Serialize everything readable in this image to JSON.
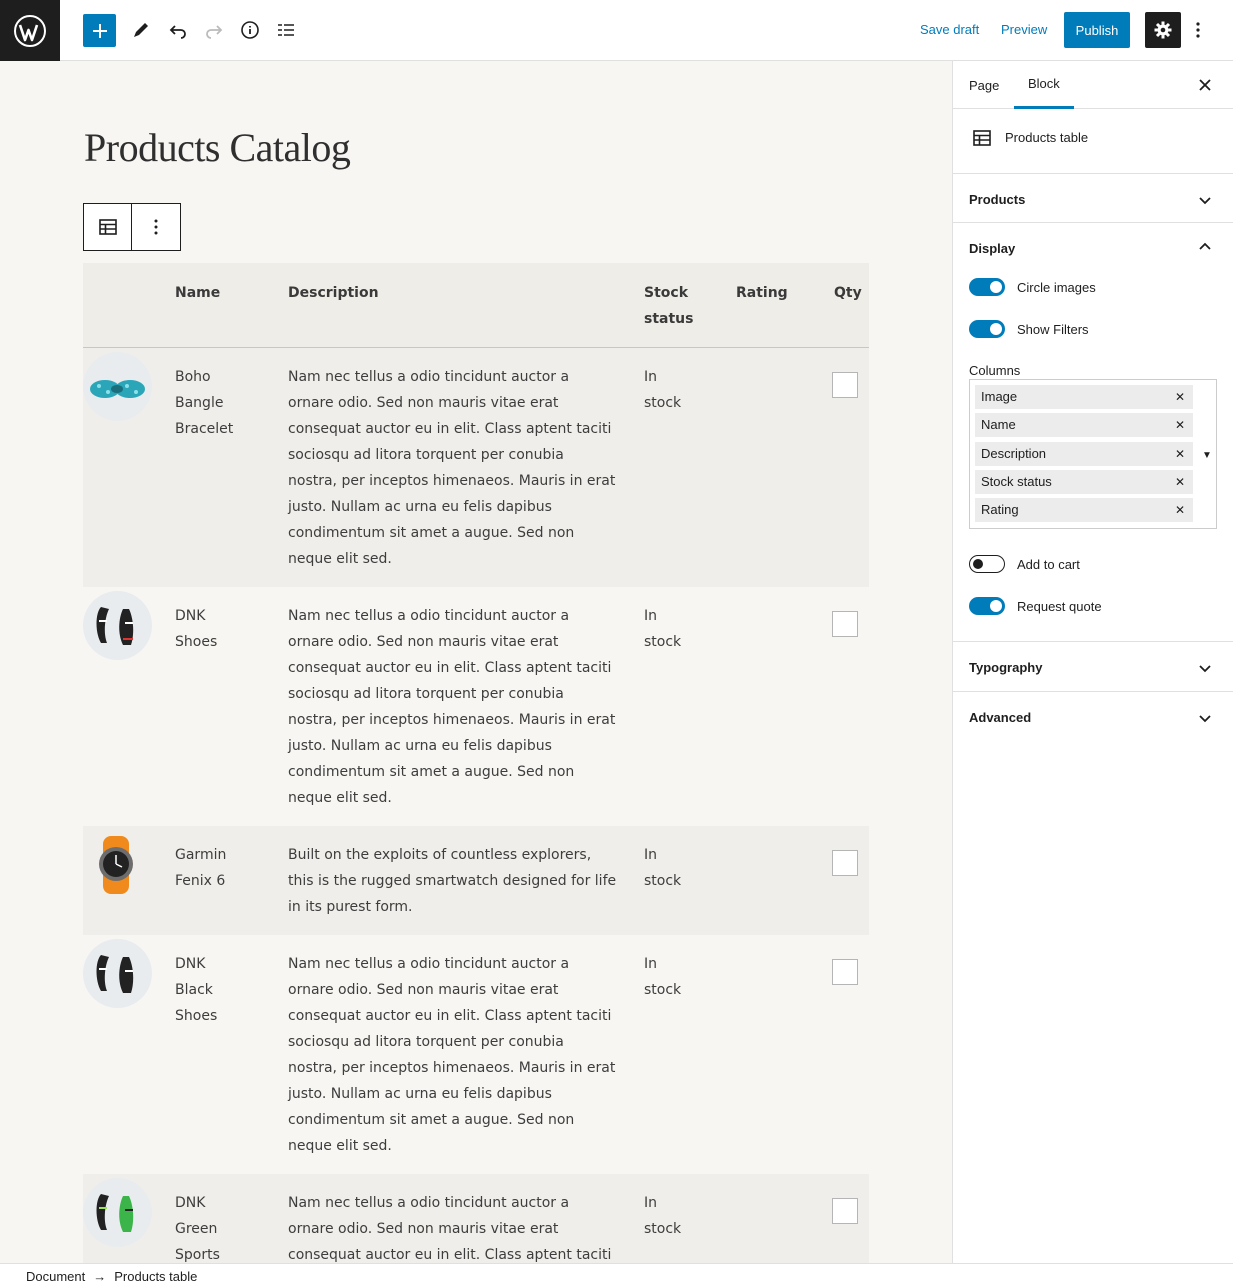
{
  "toolbar": {
    "save_draft": "Save draft",
    "preview": "Preview",
    "publish": "Publish",
    "accent": "#007cba"
  },
  "canvas": {
    "page_title": "Products Catalog"
  },
  "table": {
    "headers": [
      "Name",
      "Description",
      "Stock status",
      "Rating",
      "Qty"
    ],
    "header_stock_lines": [
      "Stock",
      "status"
    ],
    "rows": [
      {
        "image": "turquoise-bracelet",
        "name_lines": [
          "Boho",
          "Bangle",
          "Bracelet"
        ],
        "desc_lines": [
          "Nam nec tellus a odio tincidunt auctor a",
          "ornare odio. Sed non mauris vitae erat",
          "consequat auctor eu in elit. Class aptent taciti",
          "sociosqu ad litora torquent per conubia",
          "nostra, per inceptos himenaeos. Mauris in erat",
          "justo. Nullam ac urna eu felis dapibus",
          "condimentum sit amet a augue. Sed non",
          "neque elit sed."
        ],
        "stock_lines": [
          "In",
          "stock"
        ]
      },
      {
        "image": "sneakers",
        "name_lines": [
          "DNK",
          "Shoes"
        ],
        "desc_lines": [
          "Nam nec tellus a odio tincidunt auctor a",
          "ornare odio. Sed non mauris vitae erat",
          "consequat auctor eu in elit. Class aptent taciti",
          "sociosqu ad litora torquent per conubia",
          "nostra, per inceptos himenaeos. Mauris in erat",
          "justo. Nullam ac urna eu felis dapibus",
          "condimentum sit amet a augue. Sed non",
          "neque elit sed."
        ],
        "stock_lines": [
          "In",
          "stock"
        ]
      },
      {
        "image": "smartwatch",
        "name_lines": [
          "Garmin",
          "Fenix 6"
        ],
        "desc_lines": [
          "Built on the exploits of countless explorers,",
          "this is the rugged smartwatch designed for life",
          "in its purest form."
        ],
        "stock_lines": [
          "In",
          "stock"
        ]
      },
      {
        "image": "black-sneakers",
        "name_lines": [
          "DNK",
          "Black",
          "Shoes"
        ],
        "desc_lines": [
          "Nam nec tellus a odio tincidunt auctor a",
          "ornare odio. Sed non mauris vitae erat",
          "consequat auctor eu in elit. Class aptent taciti",
          "sociosqu ad litora torquent per conubia",
          "nostra, per inceptos himenaeos. Mauris in erat",
          "justo. Nullam ac urna eu felis dapibus",
          "condimentum sit amet a augue. Sed non",
          "neque elit sed."
        ],
        "stock_lines": [
          "In",
          "stock"
        ]
      },
      {
        "image": "green-sneakers",
        "name_lines": [
          "DNK",
          "Green",
          "Sports"
        ],
        "desc_lines": [
          "Nam nec tellus a odio tincidunt auctor a",
          "ornare odio. Sed non mauris vitae erat",
          "consequat auctor eu in elit. Class aptent taciti"
        ],
        "stock_lines": [
          "In",
          "stock"
        ]
      }
    ]
  },
  "sidebar": {
    "tabs": [
      "Page",
      "Block"
    ],
    "block_name": "Products table",
    "panels": {
      "products": "Products",
      "display": "Display",
      "typography": "Typography",
      "advanced": "Advanced"
    },
    "toggles": [
      {
        "label": "Circle images",
        "on": true
      },
      {
        "label": "Show Filters",
        "on": true
      },
      {
        "label": "Add to cart",
        "on": false
      },
      {
        "label": "Request quote",
        "on": true
      }
    ],
    "columns_label": "Columns",
    "columns": [
      "Image",
      "Name",
      "Description",
      "Stock status",
      "Rating"
    ]
  },
  "footer": {
    "crumbs": [
      "Document",
      "Products table"
    ]
  }
}
